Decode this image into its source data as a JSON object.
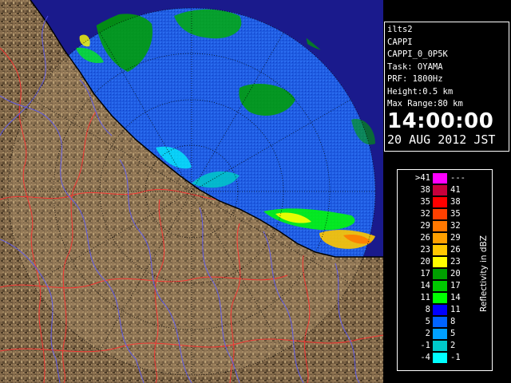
{
  "info": {
    "site": "ilts2",
    "product": "CAPPI",
    "product_id": "CAPPI_0_0P5K",
    "task": "Task: OYAMA",
    "prf": "PRF: 1800Hz",
    "height": "Height:0.5 km",
    "max_range": "Max Range:80 km",
    "time": "14:00:00",
    "date": "20 AUG 2012 JST"
  },
  "legend": {
    "title": "Reflectivity in dBZ",
    "rows": [
      {
        "lo": ">41",
        "hi": "---",
        "color": "#ff00ff"
      },
      {
        "lo": "38",
        "hi": "41",
        "color": "#c8003c"
      },
      {
        "lo": "35",
        "hi": "38",
        "color": "#ff0000"
      },
      {
        "lo": "32",
        "hi": "35",
        "color": "#ff4000"
      },
      {
        "lo": "29",
        "hi": "32",
        "color": "#ff7800"
      },
      {
        "lo": "26",
        "hi": "29",
        "color": "#ffa000"
      },
      {
        "lo": "23",
        "hi": "26",
        "color": "#ffc800"
      },
      {
        "lo": "20",
        "hi": "23",
        "color": "#ffff00"
      },
      {
        "lo": "17",
        "hi": "20",
        "color": "#00a000"
      },
      {
        "lo": "14",
        "hi": "17",
        "color": "#00c800"
      },
      {
        "lo": "11",
        "hi": "14",
        "color": "#00ff00"
      },
      {
        "lo": "8",
        "hi": "11",
        "color": "#0000ff"
      },
      {
        "lo": "5",
        "hi": "8",
        "color": "#0064ff"
      },
      {
        "lo": "2",
        "hi": "5",
        "color": "#00a0ff"
      },
      {
        "lo": "-1",
        "hi": "2",
        "color": "#00c8c8"
      },
      {
        "lo": "-4",
        "hi": "-1",
        "color": "#00ffff"
      }
    ]
  },
  "colors": {
    "background": "#000000",
    "sea_blank": "#1a1a8c",
    "radar_echo_base": "#1f5ce0",
    "land": "#7a6245",
    "land_light": "#a08660",
    "coastline": "#000000",
    "river": "#5a5aff",
    "boundary": "#ff3030"
  },
  "map": {
    "range_rings": true,
    "azimuth_lines": true
  }
}
